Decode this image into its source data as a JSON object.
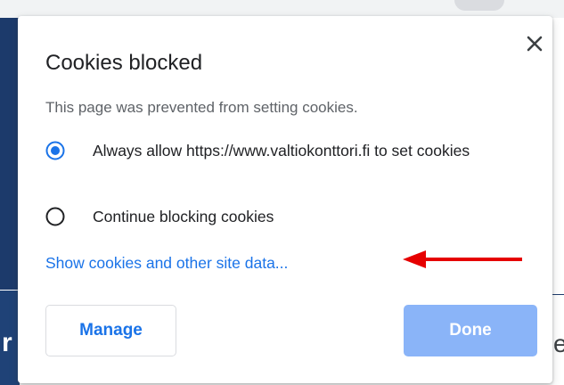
{
  "dialog": {
    "title": "Cookies blocked",
    "subtitle": "This page was prevented from setting cookies.",
    "options": [
      {
        "label": "Always allow https://www.valtiokonttori.fi to set cookies",
        "selected": true
      },
      {
        "label": "Continue blocking cookies",
        "selected": false
      }
    ],
    "link_text": "Show cookies and other site data...",
    "buttons": {
      "manage": "Manage",
      "done": "Done"
    },
    "close_icon": "close-icon"
  },
  "background": {
    "left_glyph": "r",
    "right_glyph": "e"
  },
  "annotation": {
    "arrow_color": "#e60000"
  },
  "colors": {
    "accent": "#1a73e8",
    "done_button": "#8ab4f8",
    "radio_selected": "#1a73e8",
    "page_navy": "#1c3a6b"
  }
}
